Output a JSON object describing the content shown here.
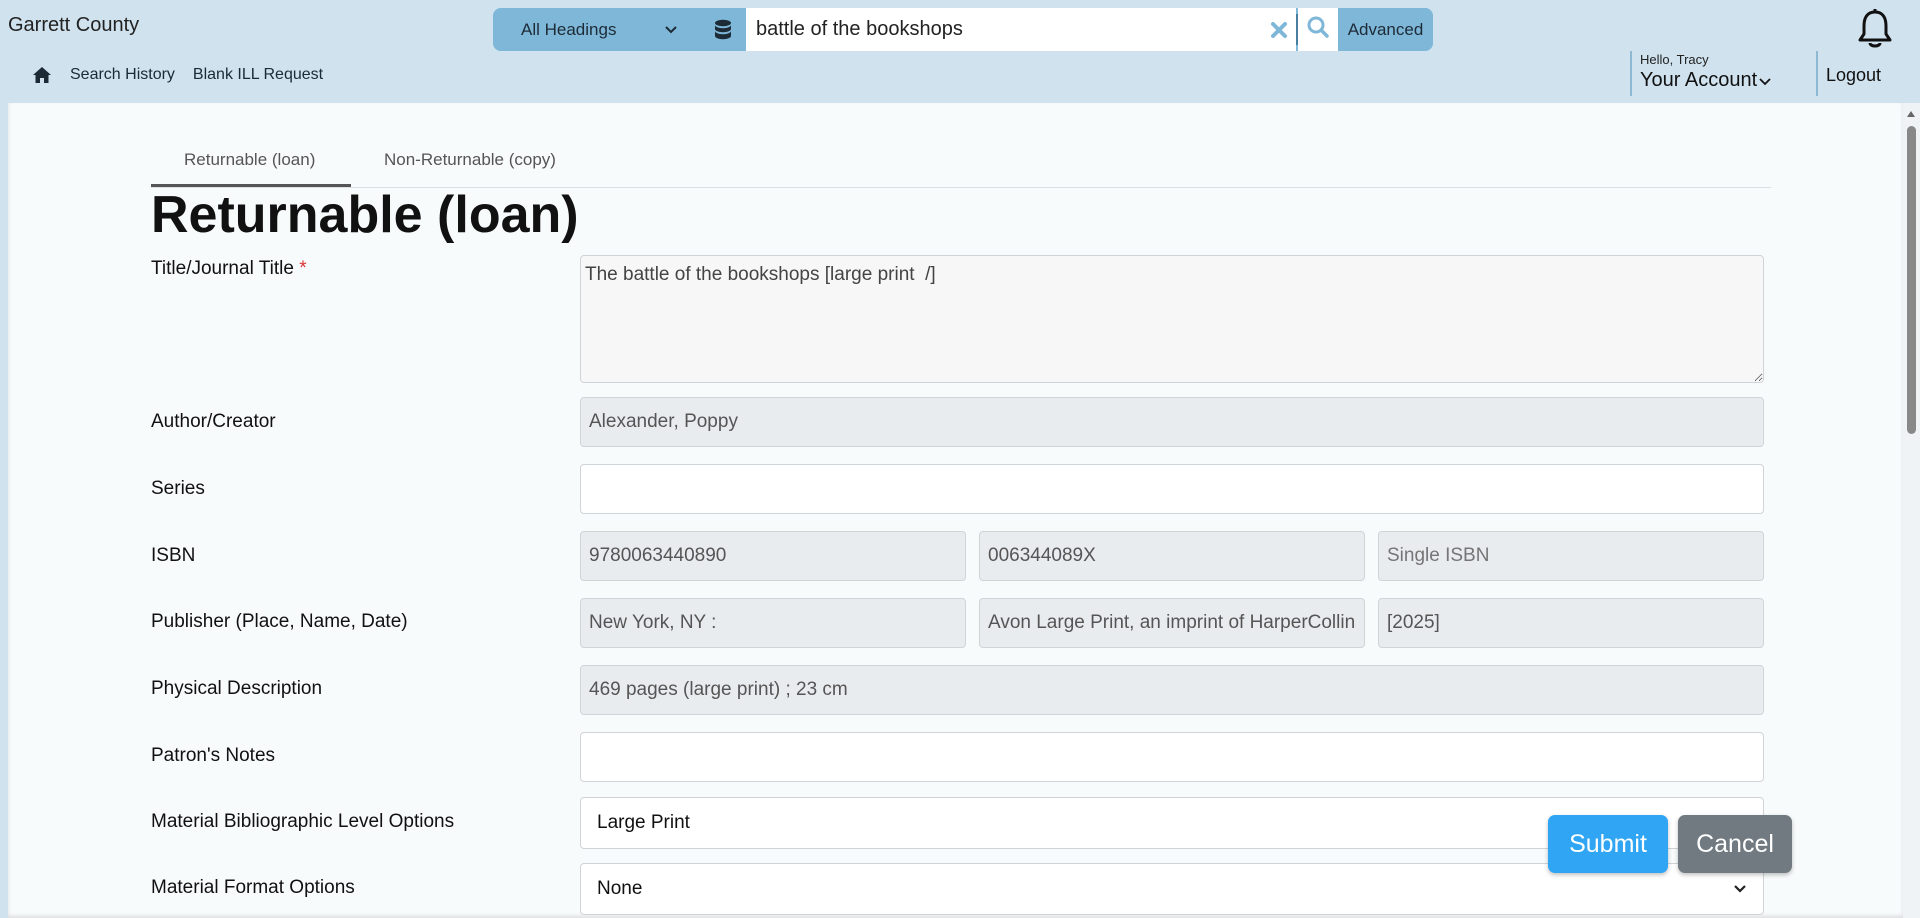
{
  "header": {
    "brand": "Garrett County",
    "search": {
      "scope": "All Headings",
      "query": "battle of the bookshops",
      "advanced_label": "Advanced"
    },
    "subnav": {
      "search_history": "Search History",
      "blank_ill": "Blank ILL Request"
    },
    "account": {
      "hello": "Hello, Tracy",
      "label": "Your Account"
    },
    "logout": "Logout"
  },
  "tabs": [
    {
      "label": "Returnable (loan)",
      "active": true
    },
    {
      "label": "Non-Returnable (copy)",
      "active": false
    }
  ],
  "form": {
    "heading": "Returnable (loan)",
    "title_label": "Title/Journal Title",
    "required_mark": "*",
    "title_value": "The battle of the bookshops [large print  /]",
    "author_label": "Author/Creator",
    "author_value": "Alexander, Poppy",
    "series_label": "Series",
    "series_value": "",
    "isbn_label": "ISBN",
    "isbn_1": "9780063440890",
    "isbn_2": "006344089X",
    "isbn_3_placeholder": "Single ISBN",
    "publisher_label": "Publisher (Place, Name, Date)",
    "pub_place": "New York, NY :",
    "pub_name": "Avon Large Print, an imprint of HarperCollins Publishers",
    "pub_date": "[2025]",
    "physdesc_label": "Physical Description",
    "physdesc_value": "469 pages (large print) ; 23 cm",
    "notes_label": "Patron's Notes",
    "notes_value": "",
    "biblevel_label": "Material Bibliographic Level Options",
    "biblevel_value": "Large Print",
    "format_label": "Material Format Options",
    "format_value": "None"
  },
  "buttons": {
    "submit": "Submit",
    "cancel": "Cancel"
  },
  "colors": {
    "header_bg": "#cfe2ee",
    "search_accent": "#7fb7d9",
    "submit": "#2fa5f3",
    "cancel": "#707a80"
  }
}
